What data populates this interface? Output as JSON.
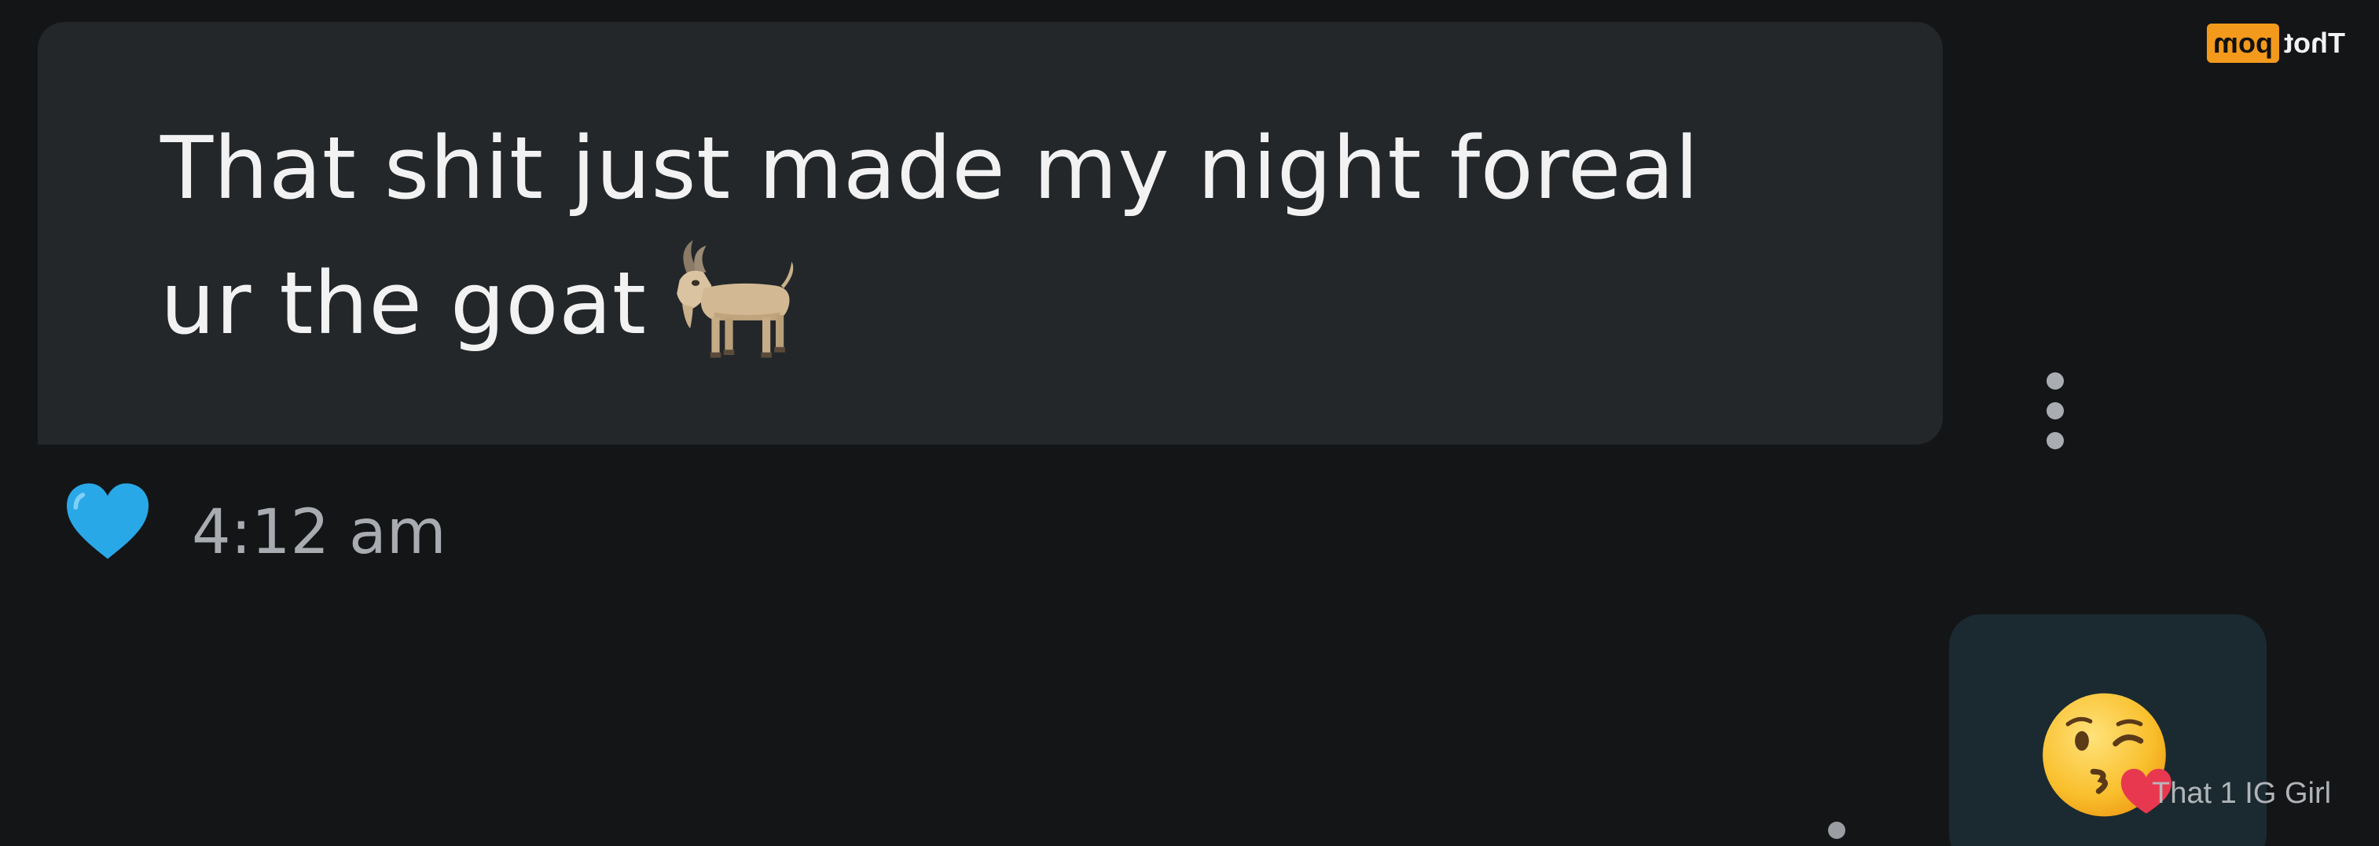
{
  "message_in": {
    "line1": "That shit just made my night foreal",
    "line2": "ur the goat",
    "emoji": "goat-emoji"
  },
  "reaction": {
    "icon": "blue-heart-icon",
    "color": "#29a8e8"
  },
  "timestamp": "4:12 am",
  "message_out": {
    "emoji": "face-blowing-kiss-emoji"
  },
  "watermarks": {
    "bottom": "That 1 IG Girl",
    "top_part_a": "Thot",
    "top_part_b": "pom"
  },
  "colors": {
    "background": "#141517",
    "bubble_in": "#23272a",
    "bubble_out": "#1b2a30",
    "text": "#f2f2f2",
    "muted_text": "#a8abb0",
    "brand_orange": "#f39a1c"
  }
}
